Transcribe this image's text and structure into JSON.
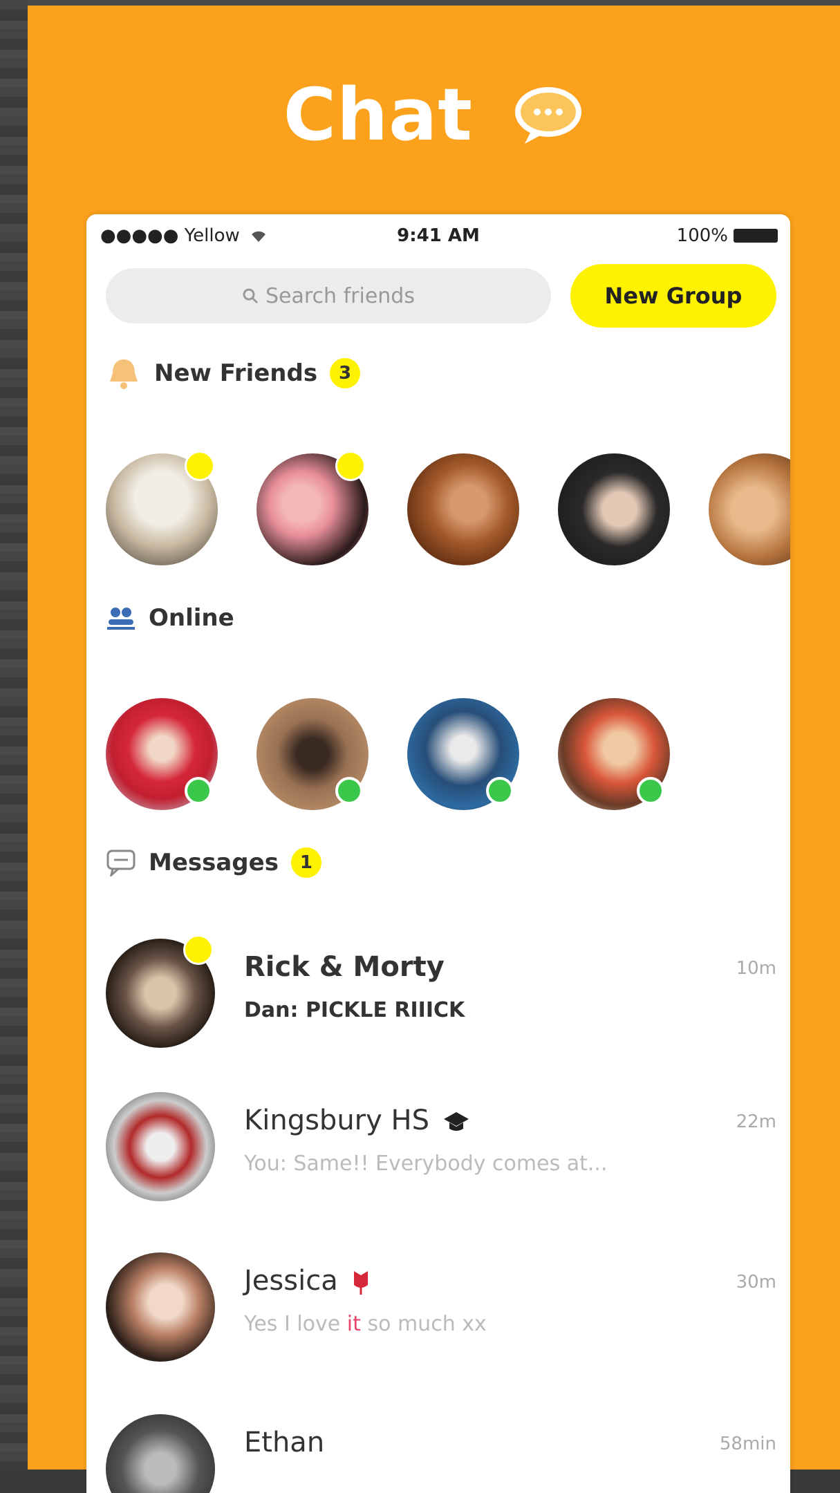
{
  "hero": {
    "title": "Chat"
  },
  "status": {
    "carrier": "●●●●● Yellow",
    "time": "9:41 AM",
    "battery": "100%"
  },
  "search": {
    "placeholder": "Search friends"
  },
  "new_group": {
    "label": "New Group"
  },
  "new_friends": {
    "label": "New Friends",
    "count": "3"
  },
  "online": {
    "label": "Online"
  },
  "messages": {
    "label": "Messages",
    "count": "1",
    "items": [
      {
        "name": "Rick & Morty",
        "preview": "Dan: PICKLE RIIICK",
        "time": "10m"
      },
      {
        "name": "Kingsbury HS",
        "preview": "You: Same!! Everybody comes at...",
        "time": "22m"
      },
      {
        "name": "Jessica",
        "preview_before": "Yes I love ",
        "preview_accent": "it",
        "preview_after": " so much xx",
        "time": "30m"
      },
      {
        "name": "Ethan",
        "time": "58min"
      }
    ]
  },
  "colors": {
    "background": "#FBA11B",
    "accent_yellow": "#FFF200",
    "online_green": "#3BC84A"
  }
}
